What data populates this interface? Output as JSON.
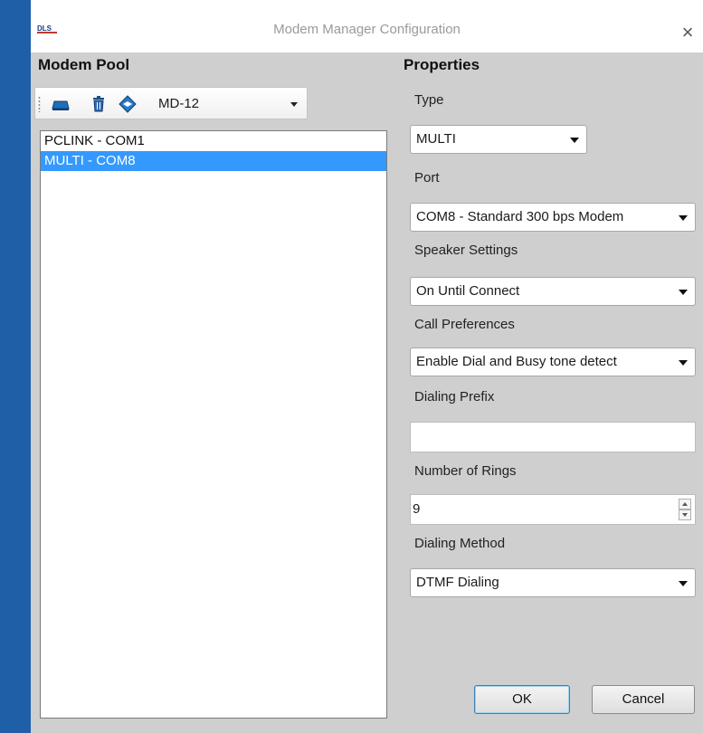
{
  "window": {
    "logo_text": "DLS",
    "title": "Modem Manager Configuration",
    "close_glyph": "×"
  },
  "modem_pool": {
    "heading": "Modem Pool",
    "toolbar": {
      "icons": [
        "modem-icon",
        "delete-icon",
        "configure-icon"
      ],
      "selected_model": "MD-12"
    },
    "items": [
      {
        "label": "PCLINK - COM1",
        "selected": false
      },
      {
        "label": "MULTI - COM8",
        "selected": true
      }
    ]
  },
  "properties": {
    "heading": "Properties",
    "type": {
      "label": "Type",
      "value": "MULTI"
    },
    "port": {
      "label": "Port",
      "value": "COM8 - Standard  300 bps Modem"
    },
    "speaker": {
      "label": "Speaker Settings",
      "value": "On Until Connect"
    },
    "call_prefs": {
      "label": "Call Preferences",
      "value": "Enable Dial and Busy tone detect"
    },
    "dialing_prefix": {
      "label": "Dialing Prefix",
      "value": ""
    },
    "rings": {
      "label": "Number of Rings",
      "value": "9"
    },
    "dialing_method": {
      "label": "Dialing Method",
      "value": "DTMF Dialing"
    }
  },
  "buttons": {
    "ok": "OK",
    "cancel": "Cancel"
  },
  "colors": {
    "selection": "#3399ff",
    "frame": "#1e5fa8"
  }
}
